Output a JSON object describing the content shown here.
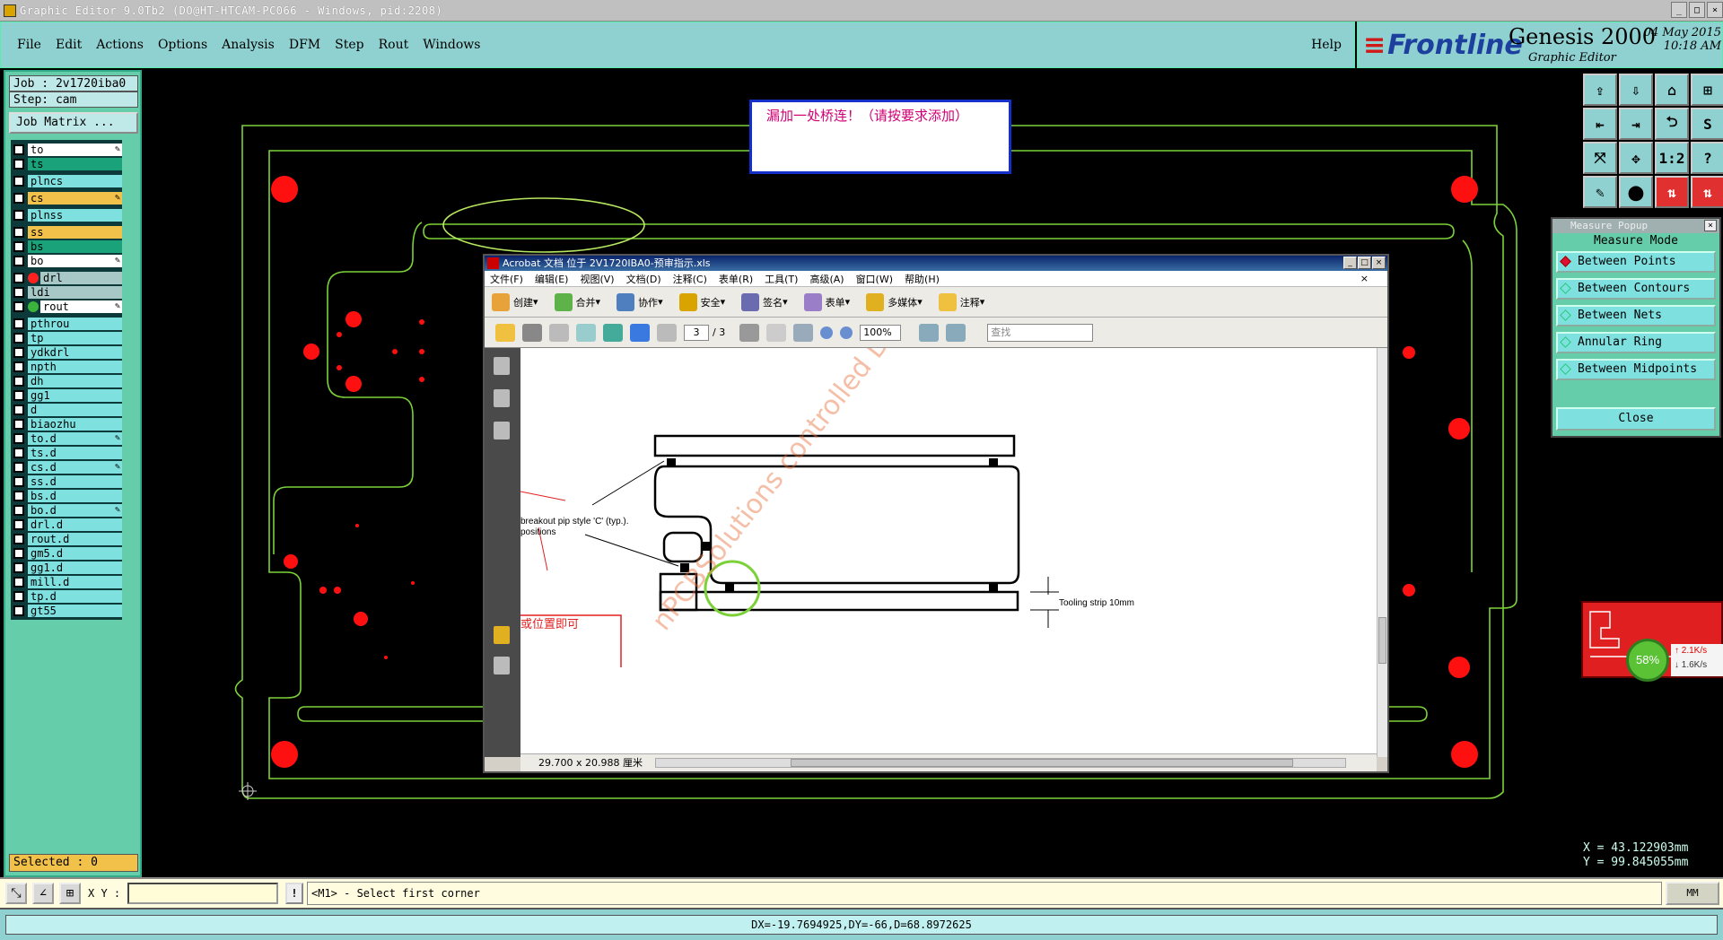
{
  "window": {
    "title": "Graphic Editor 9.0Tb2 (DO@HT-HTCAM-PC066 - Windows, pid:2208)"
  },
  "menu": {
    "items": [
      "File",
      "Edit",
      "Actions",
      "Options",
      "Analysis",
      "DFM",
      "Step",
      "Rout",
      "Windows"
    ],
    "help": "Help"
  },
  "brand": {
    "logo": "Frontline",
    "product": "Genesis 2000",
    "subtitle": "Graphic Editor",
    "date": "04 May 2015",
    "time": "10:18 AM"
  },
  "job": {
    "job": "Job : 2v1720iba0",
    "step": "Step: cam",
    "matrix_button": "Job Matrix ..."
  },
  "layers": [
    {
      "name": "to",
      "bg": "#ffffff",
      "pen": true
    },
    {
      "name": "ts",
      "bg": "#1aa37a"
    },
    {
      "name": "plncs",
      "bg": "#7fe0e0",
      "gap": true
    },
    {
      "name": "cs",
      "bg": "#f2c14a",
      "pen": true,
      "gap": true
    },
    {
      "name": "plnss",
      "bg": "#7fe0e0",
      "gap": true
    },
    {
      "name": "ss",
      "bg": "#f2c14a",
      "gap": true
    },
    {
      "name": "bs",
      "bg": "#1aa37a"
    },
    {
      "name": "bo",
      "bg": "#ffffff",
      "pen": true
    },
    {
      "name": "drl",
      "bg": "#a8c8c8",
      "dot": "#ff2020",
      "gap": true
    },
    {
      "name": "ldi",
      "bg": "#a8c8c8"
    },
    {
      "name": "rout",
      "bg": "#ffffff",
      "dot": "#3bb33b",
      "pen": true
    },
    {
      "name": "pthrou",
      "bg": "#7fe0e0",
      "gap": true
    },
    {
      "name": "tp",
      "bg": "#7fe0e0"
    },
    {
      "name": "ydkdrl",
      "bg": "#7fe0e0"
    },
    {
      "name": "npth",
      "bg": "#7fe0e0"
    },
    {
      "name": "dh",
      "bg": "#7fe0e0"
    },
    {
      "name": "gg1",
      "bg": "#7fe0e0"
    },
    {
      "name": "d",
      "bg": "#7fe0e0"
    },
    {
      "name": "biaozhu",
      "bg": "#7fe0e0"
    },
    {
      "name": "to.d",
      "bg": "#7fe0e0",
      "pen": true
    },
    {
      "name": "ts.d",
      "bg": "#7fe0e0"
    },
    {
      "name": "cs.d",
      "bg": "#7fe0e0",
      "pen": true
    },
    {
      "name": "ss.d",
      "bg": "#7fe0e0"
    },
    {
      "name": "bs.d",
      "bg": "#7fe0e0"
    },
    {
      "name": "bo.d",
      "bg": "#7fe0e0",
      "pen": true
    },
    {
      "name": "drl.d",
      "bg": "#7fe0e0"
    },
    {
      "name": "rout.d",
      "bg": "#7fe0e0"
    },
    {
      "name": "gm5.d",
      "bg": "#7fe0e0"
    },
    {
      "name": "gg1.d",
      "bg": "#7fe0e0"
    },
    {
      "name": "mill.d",
      "bg": "#7fe0e0"
    },
    {
      "name": "tp.d",
      "bg": "#7fe0e0"
    },
    {
      "name": "gt55",
      "bg": "#7fe0e0"
    }
  ],
  "selected": "Selected : 0",
  "tools": [
    "⇪",
    "⇩",
    "⌂",
    "⊞",
    "⇤",
    "⇥",
    "⮌",
    "S",
    "⤧",
    "✥",
    "1:2",
    "?",
    "✎",
    "⬤",
    "⇅",
    "⇅"
  ],
  "measure": {
    "title": "Measure Popup",
    "heading": "Measure Mode",
    "options": [
      "Between Points",
      "Between Contours",
      "Between Nets",
      "Annular Ring",
      "Between Midpoints"
    ],
    "active": 0,
    "close": "Close"
  },
  "net": {
    "percent": "58%",
    "up": "2.1K/s",
    "down": "1.6K/s"
  },
  "coords": {
    "x": "X = 43.122903mm",
    "y": "Y = 99.845055mm"
  },
  "note": {
    "text": "漏加一处桥连！（请按要求添加）"
  },
  "acrobat": {
    "title": "Acrobat 文档 位于 2V1720IBA0-预审指示.xls",
    "menu": [
      "文件(F)",
      "编辑(E)",
      "视图(V)",
      "文档(D)",
      "注释(C)",
      "表单(R)",
      "工具(T)",
      "高级(A)",
      "窗口(W)",
      "帮助(H)"
    ],
    "toolbar1": [
      "创建",
      "合并",
      "协作",
      "安全",
      "签名",
      "表单",
      "多媒体",
      "注释"
    ],
    "page_current": "3",
    "page_total": "/ 3",
    "zoom": "100%",
    "find_placeholder": "查找",
    "page_size": "29.700 x 20.988 厘米",
    "drawing": {
      "label_breakout": "breakout pip style 'C' (typ.).",
      "label_positions": "positions",
      "label_tooling": "Tooling strip 10mm",
      "label_chinese": "或位置即可",
      "watermark": "nPCBSolutions controlled Document"
    }
  },
  "command": {
    "xy_label": "X Y :",
    "prompt": "<M1> - Select first corner",
    "units": "MM"
  },
  "status": {
    "text": "DX=-19.7694925,DY=-66,D=68.8972625"
  }
}
